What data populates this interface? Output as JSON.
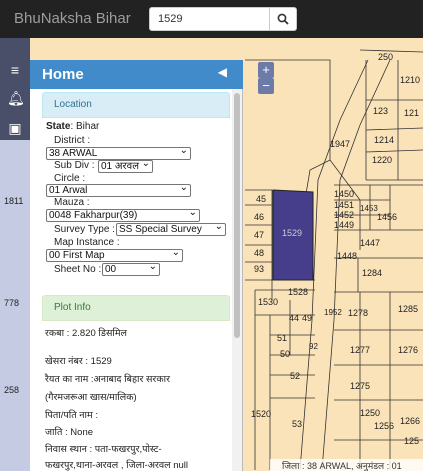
{
  "app": {
    "brand": "BhuNaksha Bihar"
  },
  "search": {
    "value": "1529"
  },
  "sidebar": {
    "title": "Home",
    "location_header": "Location",
    "state_label": "State",
    "state_value": ": Bihar",
    "district_label": "District :",
    "district_value": "38 ARWAL",
    "subdiv_label": "Sub Div :",
    "subdiv_value": "01 अरवल",
    "circle_label": "Circle :",
    "circle_value": "01 Arwal",
    "mauza_label": "Mauza :",
    "mauza_value": "0048 Fakharpur(39)",
    "survey_label": "Survey Type :",
    "survey_value": "SS Special Survey",
    "mapinst_label": "Map Instance :",
    "mapinst_value": "00 First Map",
    "sheet_label": "Sheet No :",
    "sheet_value": "00",
    "plot_header": "Plot Info",
    "plot_lines": [
      "रकबा : 2.820 डिसमिल",
      "खेसरा नंबर : 1529",
      "रैयत का नाम :अनाबाद बिहार सरकार",
      "(गैरमजरूआ खास/मालिक)",
      "पिता/पति नाम :",
      "जाति : None",
      "निवास स्थान : पता-फखरपुर,पोस्ट-",
      "फखरपुर,थाना-अरवल , जिला-अरवल null"
    ]
  },
  "map": {
    "zoom_in": "+",
    "zoom_out": "−",
    "selected_plot": "1529",
    "plot_labels": [
      "250",
      "1210",
      "123",
      "121",
      "1947",
      "1214",
      "1220",
      "45",
      "1450",
      "1451",
      "1453",
      "1452",
      "1456",
      "1449",
      "46",
      "47",
      "1447",
      "1448",
      "48",
      "1284",
      "93",
      "1528",
      "1530",
      "1278",
      "1285",
      "44",
      "49",
      "51",
      "1952",
      "50",
      "92",
      "1277",
      "1276",
      "52",
      "1275",
      "1520",
      "53",
      "1250",
      "1256",
      "1266",
      "125"
    ],
    "left_labels": [
      "1811",
      "778",
      "258"
    ],
    "attribution": "जिला : 38 ARWAL, अनुमंडल : 01",
    "colors": {
      "plot_bg": "#fbe3b9",
      "selected": "#463e8a",
      "line": "#333333"
    }
  }
}
